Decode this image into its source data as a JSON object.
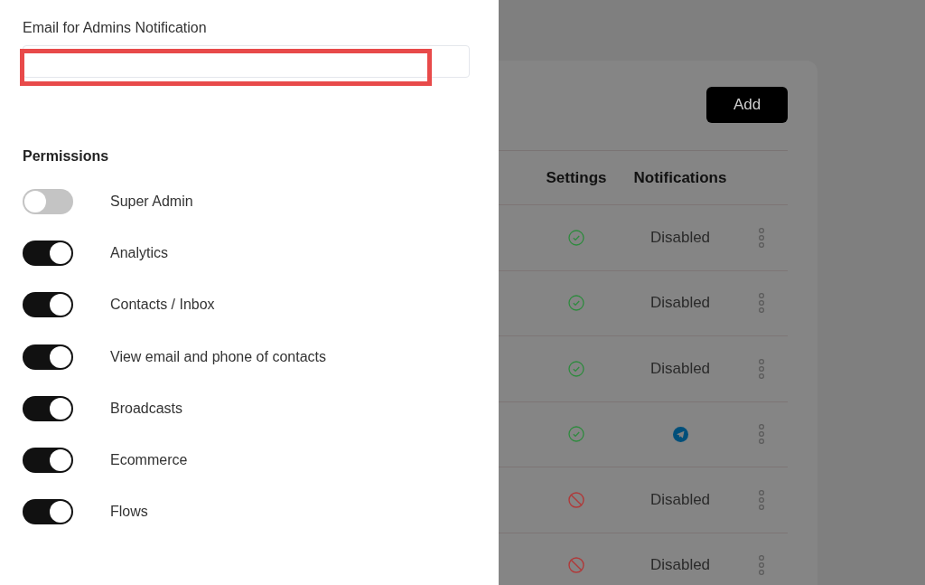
{
  "drawer": {
    "email_label": "Email for Admins Notification",
    "email_field": {
      "highlighted": true
    },
    "permissions_title": "Permissions",
    "permissions": [
      {
        "label": "Super Admin",
        "on": false
      },
      {
        "label": "Analytics",
        "on": true
      },
      {
        "label": "Contacts / Inbox",
        "on": true
      },
      {
        "label": "View email and phone of contacts",
        "on": true
      },
      {
        "label": "Broadcasts",
        "on": true
      },
      {
        "label": "Ecommerce",
        "on": true
      },
      {
        "label": "Flows",
        "on": true
      }
    ]
  },
  "background": {
    "add_button": "Add",
    "columns": [
      "Settings",
      "Notifications"
    ],
    "rows": [
      {
        "settings_allowed": true,
        "notification": {
          "kind": "text",
          "text": "Disabled"
        }
      },
      {
        "settings_allowed": true,
        "notification": {
          "kind": "text",
          "text": "Disabled"
        }
      },
      {
        "settings_allowed": true,
        "notification": {
          "kind": "text",
          "text": "Disabled"
        }
      },
      {
        "settings_allowed": true,
        "notification": {
          "kind": "telegram"
        }
      },
      {
        "settings_allowed": false,
        "notification": {
          "kind": "text",
          "text": "Disabled"
        }
      },
      {
        "settings_allowed": false,
        "notification": {
          "kind": "text",
          "text": "Disabled"
        }
      }
    ]
  }
}
